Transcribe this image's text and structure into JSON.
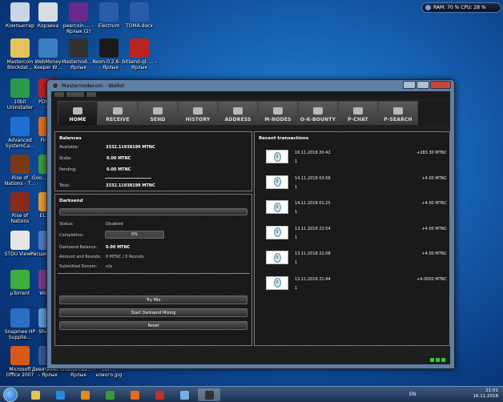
{
  "desktop": {
    "icons": [
      {
        "label": "Компьютер",
        "icon": "computer-icon",
        "color": "#c9d6e6"
      },
      {
        "label": "Корзина",
        "icon": "recycle-bin-icon",
        "color": "#d8dde2"
      },
      {
        "label": "peercoin-… - Ярлык (2)",
        "icon": "peercoin-icon",
        "color": "#6a2a8a"
      },
      {
        "label": "Electrum",
        "icon": "electrum-icon",
        "color": "#2a5caa"
      },
      {
        "label": "TOMA.docx",
        "icon": "word-doc-icon",
        "color": "#2b5cab"
      },
      {
        "label": "Mastercoin Blockdat…",
        "icon": "folder-icon",
        "color": "#e6c35a"
      },
      {
        "label": "WebMoney Keeper W…",
        "icon": "webmoney-icon",
        "color": "#3c7fc0"
      },
      {
        "label": "Masternod… - Ярлык",
        "icon": "masternode-icon",
        "color": "#333333"
      },
      {
        "label": "Neon-0.2.6-… - Ярлык",
        "icon": "neon-icon",
        "color": "#1a1a1a"
      },
      {
        "label": "bitsend-qt-… - Ярлык",
        "icon": "bitsend-icon",
        "color": "#bb2222"
      },
      {
        "label": "10bit Uninstaller",
        "icon": "uninstaller-icon",
        "color": "#2a9a4a"
      },
      {
        "label": "PDF-X…",
        "icon": "pdf-icon",
        "color": "#c02020"
      },
      {
        "label": "Advanced SystemCa…",
        "icon": "systemcare-icon",
        "color": "#1f6fd0"
      },
      {
        "label": "Firef…",
        "icon": "firefox-icon",
        "color": "#e56a1f"
      },
      {
        "label": "Rise of Nations - T…",
        "icon": "game-icon",
        "color": "#7a3a1a"
      },
      {
        "label": "Goo… Chro…",
        "icon": "chrome-icon",
        "color": "#3a9a3a"
      },
      {
        "label": "Rise of Nations",
        "icon": "game-icon",
        "color": "#8a2a1a"
      },
      {
        "label": "EL…ge",
        "icon": "app-icon",
        "color": "#e09a30"
      },
      {
        "label": "STDU Viewer",
        "icon": "stdu-icon",
        "color": "#e6e6e6"
      },
      {
        "label": "Расширение…",
        "icon": "app-icon",
        "color": "#4a7ac0"
      },
      {
        "label": "µTorrent",
        "icon": "utorrent-icon",
        "color": "#3fae3f"
      },
      {
        "label": "WinR…",
        "icon": "winrar-icon",
        "color": "#7a3a8a"
      },
      {
        "label": "Snapmee HP Supplie…",
        "icon": "hp-icon",
        "color": "#2a6fc0"
      },
      {
        "label": "Share…",
        "icon": "share-icon",
        "color": "#5a9ad0"
      },
      {
        "label": "Microsoft Office 2007",
        "icon": "office-icon",
        "color": "#d85a1a"
      },
      {
        "label": "Девятимес… - Ярлык",
        "icon": "shortcut-icon",
        "color": "#2e5e9a"
      },
      {
        "label": "mixcoin.ex… - Ярлык",
        "icon": "shortcut-icon",
        "color": "#333333"
      },
      {
        "label": "con… нового.jpg",
        "icon": "image-icon",
        "color": "#8aa0b8"
      }
    ]
  },
  "gadget": {
    "text": "RAM: 70 %  CPU: 28 %"
  },
  "window": {
    "title": "Masternodecoin - Wallet",
    "tabs": [
      {
        "label": "HOME",
        "active": true
      },
      {
        "label": "RECEIVE",
        "active": false
      },
      {
        "label": "SEND",
        "active": false
      },
      {
        "label": "HISTORY",
        "active": false
      },
      {
        "label": "ADDRESS",
        "active": false
      },
      {
        "label": "M-NODES",
        "active": false
      },
      {
        "label": "O-K-BOUNTY",
        "active": false
      },
      {
        "label": "P-CHAT",
        "active": false
      },
      {
        "label": "P-SEARCH",
        "active": false
      }
    ],
    "balances": {
      "title": "Balances",
      "available_label": "Available:",
      "available_value": "3332.11938199 MTNC",
      "stake_label": "Stake:",
      "stake_value": "0.00 MTNC",
      "pending_label": "Pending:",
      "pending_value": "0.00 MTNC",
      "total_label": "Total:",
      "total_value": "3332.11938199 MTNC"
    },
    "darksend": {
      "title": "Darksend",
      "status_label": "Status:",
      "status_value": "Disabled",
      "completion_label": "Completion:",
      "completion_value": "0%",
      "completion_fraction": 0,
      "balance_label": "Darksend Balance:",
      "balance_value": "0.00 MTNC",
      "rounds_label": "Amount and Rounds:",
      "rounds_value": "0 MTNC / 0 Rounds",
      "denom_label": "Submitted Denom:",
      "denom_value": "n/a",
      "try_mix": "Try Mix",
      "start_mixing": "Start Darksend Mixing",
      "reset": "Reset"
    },
    "recent": {
      "title": "Recent transactions",
      "items": [
        {
          "date": "16.11.2018 20:42",
          "amount": "+283.30 MTNC",
          "confirmations": "1"
        },
        {
          "date": "14.11.2018 03:56",
          "amount": "+4.00 MTNC",
          "confirmations": "1"
        },
        {
          "date": "14.11.2018 01:25",
          "amount": "+4.00 MTNC",
          "confirmations": "1"
        },
        {
          "date": "13.11.2018 22:54",
          "amount": "+4.00 MTNC",
          "confirmations": "1"
        },
        {
          "date": "13.11.2018 22:08",
          "amount": "+4.00 MTNC",
          "confirmations": "1"
        },
        {
          "date": "13.11.2018 21:44",
          "amount": "+4.0002 MTNC",
          "confirmations": "1"
        }
      ]
    }
  },
  "taskbar": {
    "lang": "EN",
    "time": "21:01",
    "date": "16.11.2018",
    "apps": [
      {
        "icon": "explorer-icon",
        "color": "#e6c35a"
      },
      {
        "icon": "ie-icon",
        "color": "#2a8ad8"
      },
      {
        "icon": "media-player-icon",
        "color": "#e08a20"
      },
      {
        "icon": "chrome-icon",
        "color": "#3a9a3a"
      },
      {
        "icon": "firefox-icon",
        "color": "#e56a1f"
      },
      {
        "icon": "ccleaner-icon",
        "color": "#c03030"
      },
      {
        "icon": "paint-icon",
        "color": "#7ab0e0"
      },
      {
        "icon": "masternode-icon",
        "color": "#333333"
      }
    ]
  }
}
